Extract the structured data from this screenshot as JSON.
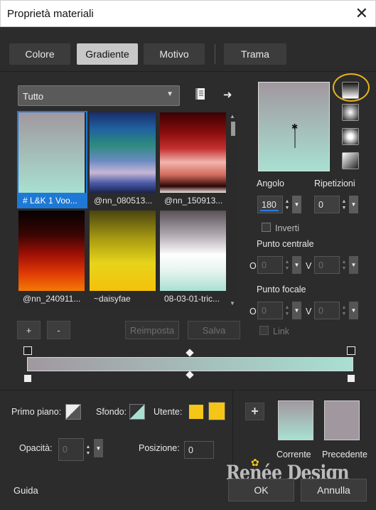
{
  "window": {
    "title": "Proprietà materiali"
  },
  "tabs": [
    {
      "label": "Colore",
      "active": false
    },
    {
      "label": "Gradiente",
      "active": true
    },
    {
      "label": "Motivo",
      "active": false
    },
    {
      "label": "Trama",
      "active": false
    }
  ],
  "category_dropdown": {
    "value": "Tutto"
  },
  "gallery": {
    "items": [
      {
        "label": "# L&K 1 Voo...",
        "selected": true,
        "colors": [
          "#a1989f",
          "#a8e0d1"
        ]
      },
      {
        "label": "@nn_080513...",
        "selected": false,
        "colors": [
          "#1f3f8c",
          "#2b8a7e",
          "#c7b7d6",
          "#4a5aa8",
          "#1a2450"
        ]
      },
      {
        "label": "@nn_150913...",
        "selected": false,
        "colors": [
          "#4a0508",
          "#b01a1a",
          "#f2b5ad",
          "#c44a3e",
          "#2a0505"
        ]
      },
      {
        "label": "@nn_240911...",
        "selected": false,
        "colors": [
          "#050202",
          "#6a0a05",
          "#d92a05",
          "#f57a05"
        ]
      },
      {
        "label": "~daisyfae",
        "selected": false,
        "colors": [
          "#5a5410",
          "#c9bb12",
          "#f2e020",
          "#f5c10c"
        ]
      },
      {
        "label": "08-03-01-tric...",
        "selected": false,
        "colors": [
          "#5a5058",
          "#c8c2c8",
          "#ffffff",
          "#a8e0d1"
        ]
      }
    ]
  },
  "buttons": {
    "add": "+",
    "remove": "-",
    "reload": "Reimposta",
    "save": "Salva",
    "ok": "OK",
    "cancel": "Annulla",
    "help": "Guida"
  },
  "gradient": {
    "start_color": "#a1989f",
    "end_color": "#a8e0d1",
    "angle_label": "Angolo",
    "angle_value": "180",
    "repeats_label": "Ripetizioni",
    "repeats_value": "0",
    "invert_label": "Inverti",
    "center_label": "Punto centrale",
    "focal_label": "Punto focale",
    "axis_h": "O",
    "axis_v": "V",
    "center_h": "0",
    "center_v": "0",
    "focal_h": "0",
    "focal_v": "0",
    "link_label": "Link"
  },
  "bottom": {
    "foreground_label": "Primo piano:",
    "background_label": "Sfondo:",
    "user_label": "Utente:",
    "user_color": "#f5c518",
    "opacity_label": "Opacità:",
    "opacity_value": "0",
    "position_label": "Posizione:",
    "position_value": "0",
    "current_label": "Corrente",
    "previous_label": "Precedente",
    "current_color_top": "#a1989f",
    "current_color_bottom": "#a8e0d1",
    "previous_color": "#a1989f"
  },
  "watermark": "Renée Design",
  "accent_color": "#1e79d6",
  "highlight_color": "#e8b41a"
}
